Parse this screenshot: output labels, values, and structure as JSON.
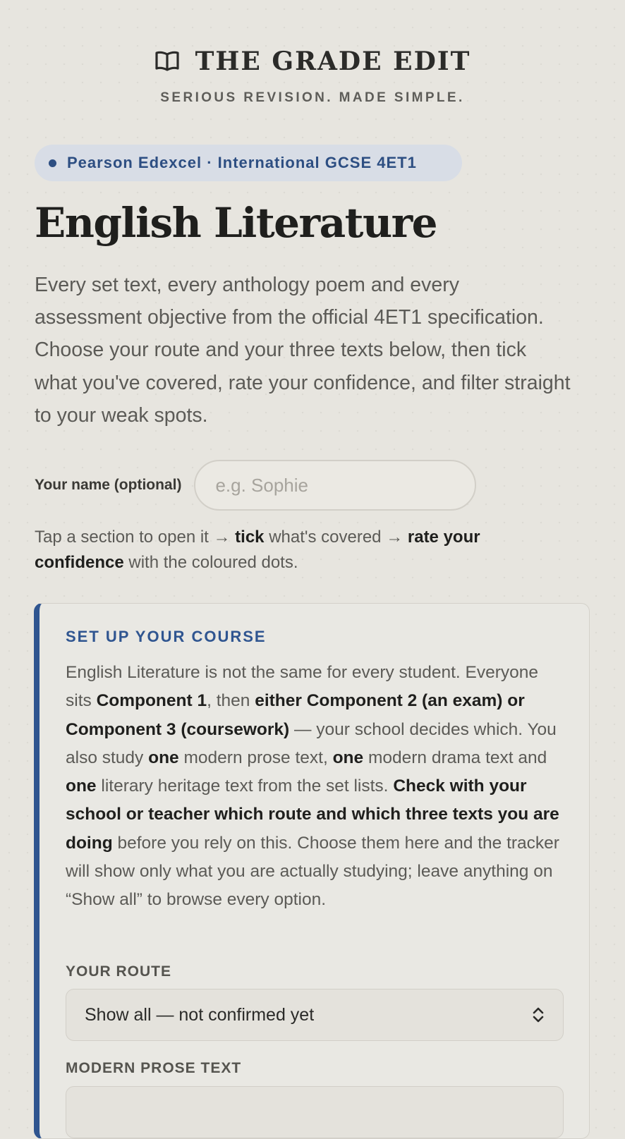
{
  "brand": {
    "name": "THE GRADE EDIT",
    "tagline": "SERIOUS REVISION. MADE SIMPLE.",
    "logo_icon": "open-book-icon"
  },
  "badge": {
    "text": "Pearson Edexcel · International GCSE 4ET1"
  },
  "page": {
    "title": "English Literature",
    "intro": "Every set text, every anthology poem and every assessment objective from the official 4ET1 specification. Choose your route and your three texts below, then tick what you've covered, rate your confidence, and filter straight to your weak spots."
  },
  "name_field": {
    "label": "Your name (optional)",
    "placeholder": "e.g. Sophie",
    "value": ""
  },
  "instructions": {
    "part1": "Tap a section to open it → ",
    "tick": "tick",
    "part2": " what's covered → ",
    "rate": "rate your confidence",
    "part3": " with the coloured dots."
  },
  "setup": {
    "heading": "SET UP YOUR COURSE",
    "body": {
      "t1": "English Literature is not the same for every student. Everyone sits ",
      "b1": "Component 1",
      "t2": ", then ",
      "b2": "either Component 2 (an exam) or Component 3 (coursework)",
      "t3": " — your school decides which. You also study ",
      "b3": "one",
      "t4": " modern prose text, ",
      "b4": "one",
      "t5": " modern drama text and ",
      "b5": "one",
      "t6": " literary heritage text from the set lists. ",
      "b6": "Check with your school or teacher which route and which three texts you are doing",
      "t7": " before you rely on this. Choose them here and the tracker will show only what you are actually studying; leave anything on “Show all” to browse every option."
    },
    "route": {
      "label": "YOUR ROUTE",
      "selected": "Show all — not confirmed yet"
    },
    "prose": {
      "label": "MODERN PROSE TEXT"
    }
  },
  "colors": {
    "accent": "#2f5590",
    "badge_bg": "#d8dde6",
    "background": "#e7e5df"
  }
}
